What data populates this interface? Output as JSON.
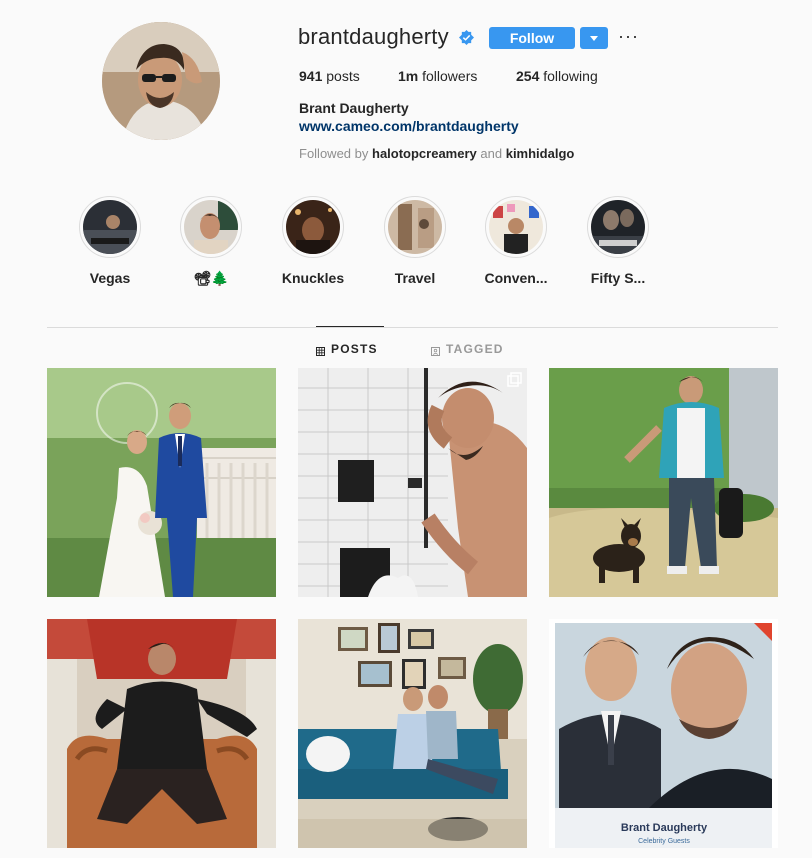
{
  "profile": {
    "username": "brantdaugherty",
    "follow_label": "Follow",
    "more_label": "···",
    "stats": {
      "posts_count": "941",
      "posts_label": "posts",
      "followers_count": "1m",
      "followers_label": "followers",
      "following_count": "254",
      "following_label": "following"
    },
    "full_name": "Brant Daugherty",
    "website": "www.cameo.com/brantdaugherty",
    "followed_by_prefix": "Followed by",
    "followed_by_1": "halotopcreamery",
    "followed_by_and": "and",
    "followed_by_2": "kimhidalgo"
  },
  "highlights": [
    {
      "label": "Vegas"
    },
    {
      "label": "📽🌲"
    },
    {
      "label": "Knuckles"
    },
    {
      "label": "Travel"
    },
    {
      "label": "Conven..."
    },
    {
      "label": "Fifty S..."
    }
  ],
  "tabs": {
    "posts": "POSTS",
    "tagged": "TAGGED"
  },
  "posts": [
    {
      "subject": "wedding photo"
    },
    {
      "subject": "shower selfie"
    },
    {
      "subject": "walking dog"
    },
    {
      "subject": "red throne"
    },
    {
      "subject": "couple on blue sofa"
    },
    {
      "subject": "celebrity guests promo",
      "caption": "Brant Daugherty",
      "subcaption": "Celebrity Guests"
    }
  ],
  "colors": {
    "accent": "#3897f0",
    "link": "#003569",
    "muted": "#8e8e8e",
    "text": "#262626",
    "background": "#fafafa"
  },
  "icons": [
    "verified-badge-icon",
    "chevron-down-icon",
    "more-options-icon",
    "grid-icon",
    "tagged-icon",
    "multi-photo-icon"
  ]
}
